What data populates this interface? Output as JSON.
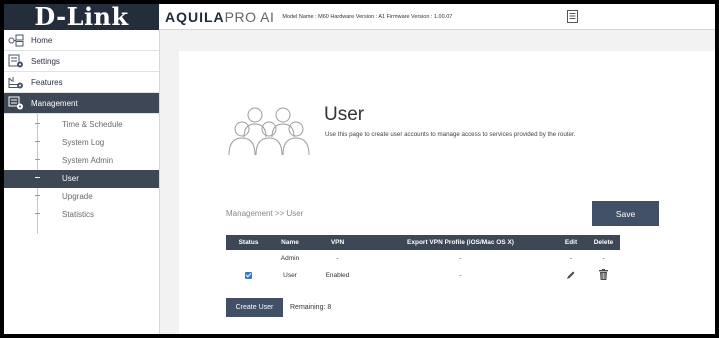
{
  "logo": "D-Link",
  "header": {
    "brand_main": "AQUILA",
    "brand_sub": "PRO AI",
    "info": "Model Name : M60 Hardware Version : A1 Firmware Version : 1.00.07"
  },
  "sidebar": {
    "items": [
      {
        "label": "Home",
        "icon": "home-network-icon"
      },
      {
        "label": "Settings",
        "icon": "settings-icon"
      },
      {
        "label": "Features",
        "icon": "features-icon"
      },
      {
        "label": "Management",
        "icon": "management-icon"
      }
    ],
    "sub_items": [
      {
        "label": "Time & Schedule"
      },
      {
        "label": "System Log"
      },
      {
        "label": "System Admin"
      },
      {
        "label": "User"
      },
      {
        "label": "Upgrade"
      },
      {
        "label": "Statistics"
      }
    ]
  },
  "page": {
    "title": "User",
    "description": "Use this page to create user accounts to manage access to services provided by the router.",
    "breadcrumb": "Management >> User",
    "save_label": "Save"
  },
  "table": {
    "headers": [
      "Status",
      "Name",
      "VPN",
      "Export VPN Profile (iOS/Mac OS X)",
      "Edit",
      "Delete"
    ],
    "rows": [
      {
        "status": "",
        "name": "Admin",
        "vpn": "-",
        "export": "-",
        "edit": "-",
        "delete": "-"
      },
      {
        "status": "checked",
        "name": "User",
        "vpn": "Enabled",
        "export": "-",
        "edit": "pencil-icon",
        "delete": "trash-icon"
      }
    ]
  },
  "footer": {
    "create_label": "Create User",
    "remaining": "Remaining: 8"
  },
  "colors": {
    "dark_nav": "#3d4756",
    "button": "#415067",
    "logo_bg": "#232d3c",
    "checkbox": "#3b78c3"
  }
}
